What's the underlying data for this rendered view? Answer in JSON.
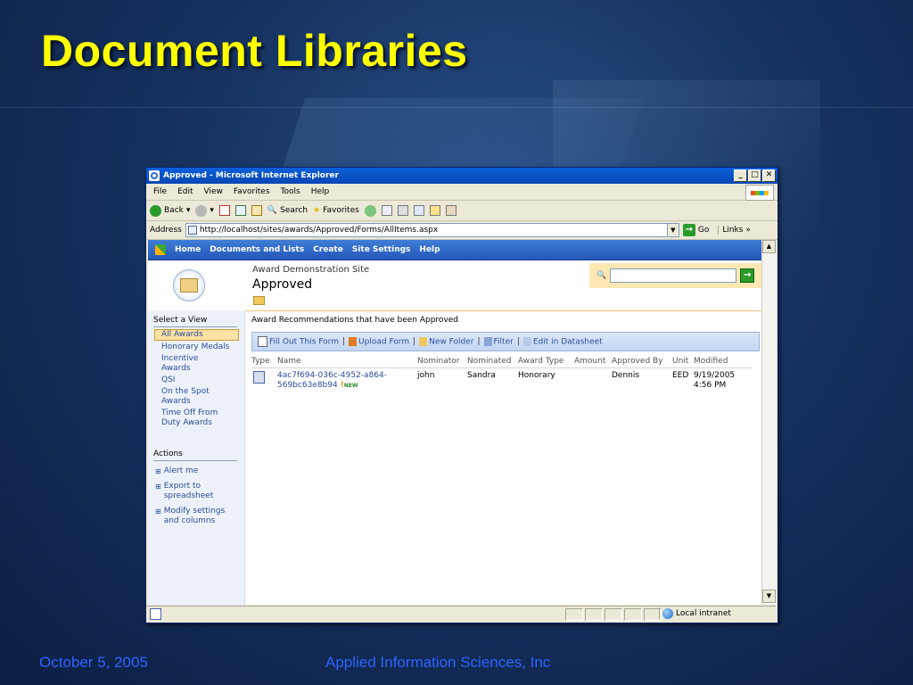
{
  "slide": {
    "title": "Document Libraries",
    "footer_date": "October 5, 2005",
    "footer_company": "Applied Information Sciences, Inc"
  },
  "browser": {
    "window_title": "Approved - Microsoft Internet Explorer",
    "menu": [
      "File",
      "Edit",
      "View",
      "Favorites",
      "Tools",
      "Help"
    ],
    "toolbar": {
      "back": "Back",
      "search": "Search",
      "favorites": "Favorites"
    },
    "address_label": "Address",
    "address_url": "http://localhost/sites/awards/Approved/Forms/AllItems.aspx",
    "go_label": "Go",
    "links_label": "Links",
    "status_zone": "Local intranet"
  },
  "sharepoint": {
    "topnav": [
      "Home",
      "Documents and Lists",
      "Create",
      "Site Settings",
      "Help"
    ],
    "site_name": "Award Demonstration Site",
    "list_title": "Approved",
    "left_nav": {
      "select_heading": "Select a View",
      "views": [
        {
          "label": "All Awards",
          "active": true
        },
        {
          "label": "Honorary Medals"
        },
        {
          "label": "Incentive Awards"
        },
        {
          "label": "QSI"
        },
        {
          "label": "On the Spot Awards"
        },
        {
          "label": "Time Off From Duty Awards"
        }
      ],
      "actions_heading": "Actions",
      "actions": [
        "Alert me",
        "Export to spreadsheet",
        "Modify settings and columns"
      ]
    },
    "description": "Award Recommendations that have been Approved",
    "list_toolbar": [
      "Fill Out This Form",
      "Upload Form",
      "New Folder",
      "Filter",
      "Edit in Datasheet"
    ],
    "columns": [
      "Type",
      "Name",
      "Nominator",
      "Nominated",
      "Award Type",
      "Amount",
      "Approved By",
      "Unit",
      "Modified"
    ],
    "rows": [
      {
        "name_line1": "4ac7f694-036c-4952-a864-",
        "name_line2": "569bc63e8b94",
        "new_badge": "NEW",
        "nominator": "john",
        "nominated": "Sandra",
        "award_type": "Honorary",
        "amount": "",
        "approved_by": "Dennis",
        "unit": "EED",
        "modified_date": "9/19/2005",
        "modified_time": "4:56 PM"
      }
    ]
  },
  "colors": {
    "title_yellow": "#ffff00",
    "footer_blue": "#2d63ff",
    "sp_nav_blue": "#2457b8",
    "link_blue": "#2a4c9a"
  }
}
